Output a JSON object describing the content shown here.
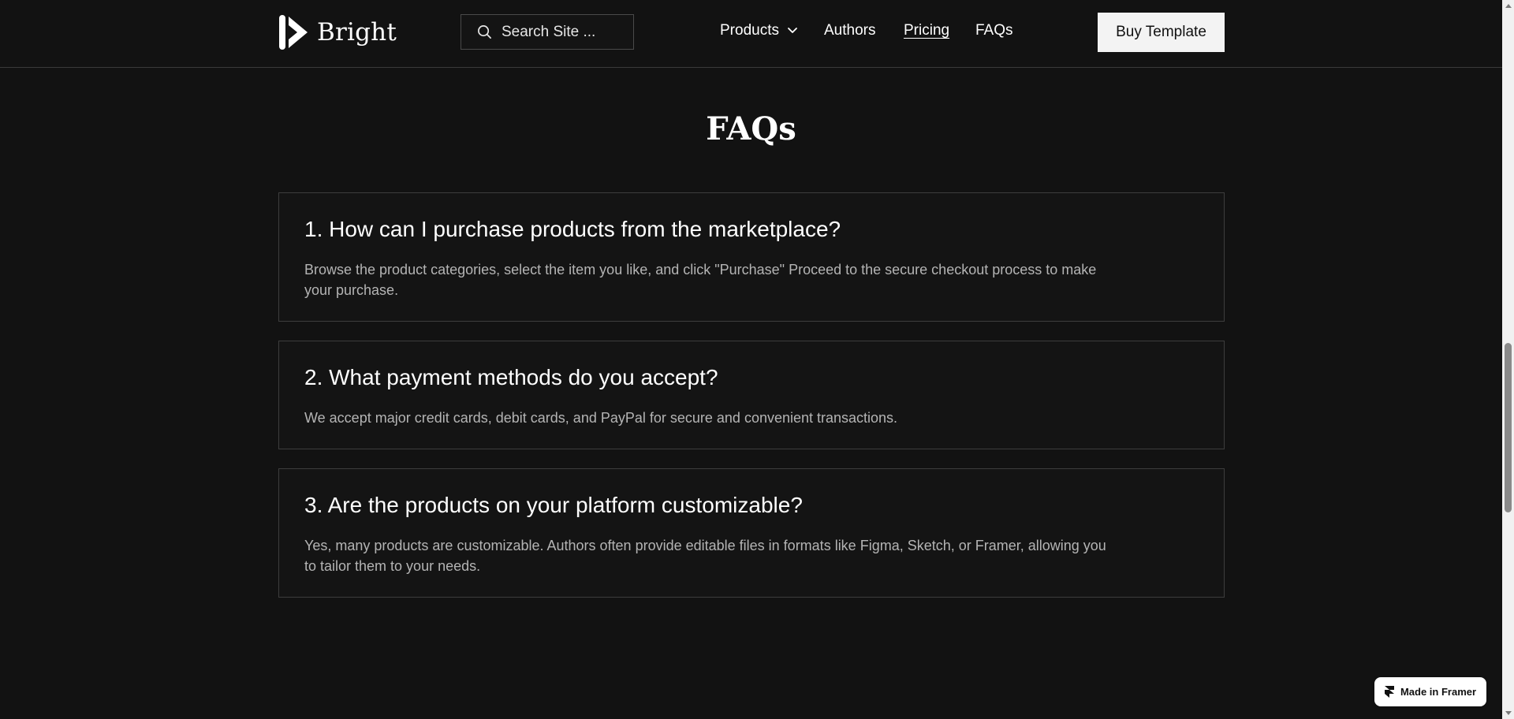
{
  "header": {
    "brand": "Bright",
    "search_placeholder": "Search Site ...",
    "nav": [
      {
        "label": "Products",
        "has_dropdown": true
      },
      {
        "label": "Authors"
      },
      {
        "label": "Pricing",
        "active": true
      },
      {
        "label": "FAQs"
      }
    ],
    "cta_label": "Buy Template"
  },
  "main": {
    "title": "FAQs",
    "faqs": [
      {
        "question": "1. How can I purchase products from the marketplace?",
        "answer": "Browse the product categories, select the item you like, and click \"Purchase\" Proceed to the secure checkout process to make your purchase."
      },
      {
        "question": "2. What payment methods do you accept?",
        "answer": "We accept major credit cards, debit cards, and PayPal for secure and convenient transactions."
      },
      {
        "question": "3. Are the products on your platform customizable?",
        "answer": "Yes, many products are customizable. Authors often provide editable files in formats like Figma, Sketch, or Framer, allowing you to tailor them to your needs."
      }
    ]
  },
  "badge": {
    "label": "Made in Framer"
  },
  "colors": {
    "background": "#121212",
    "border": "#3d3d3d",
    "answer_text": "#b4b4b4",
    "button_bg": "#f3f3f3"
  },
  "icons": [
    "brand-logo-icon",
    "search-icon",
    "chevron-down-icon",
    "framer-icon"
  ]
}
